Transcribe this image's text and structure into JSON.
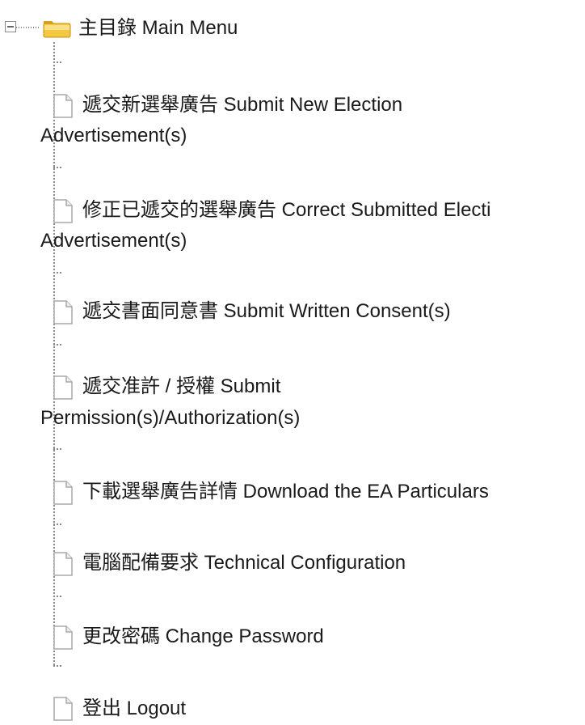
{
  "menu": {
    "root_label": "主目錄 Main Menu",
    "items": [
      {
        "line1": "遞交新選舉廣告 Submit New Election",
        "line2": "Advertisement(s)"
      },
      {
        "line1": "修正已遞交的選舉廣告 Correct Submitted Electi",
        "line2": "Advertisement(s)"
      },
      {
        "line1": "遞交書面同意書 Submit Written Consent(s)",
        "line2": ""
      },
      {
        "line1": "遞交准許 / 授權 Submit",
        "line2": "Permission(s)/Authorization(s)"
      },
      {
        "line1": "下載選舉廣告詳情 Download the EA Particulars",
        "line2": ""
      },
      {
        "line1": "電腦配備要求 Technical Configuration",
        "line2": ""
      },
      {
        "line1": "更改密碼 Change Password",
        "line2": ""
      },
      {
        "line1": "登出 Logout",
        "line2": ""
      }
    ]
  },
  "icons": {
    "collapse": "collapse-minus-icon",
    "folder": "folder-open-icon",
    "document": "document-icon"
  },
  "colors": {
    "folder_fill": "#f5c842",
    "folder_shade": "#d9a21b",
    "tree_line": "#8a8a8a",
    "doc_border": "#a8a8a8"
  }
}
